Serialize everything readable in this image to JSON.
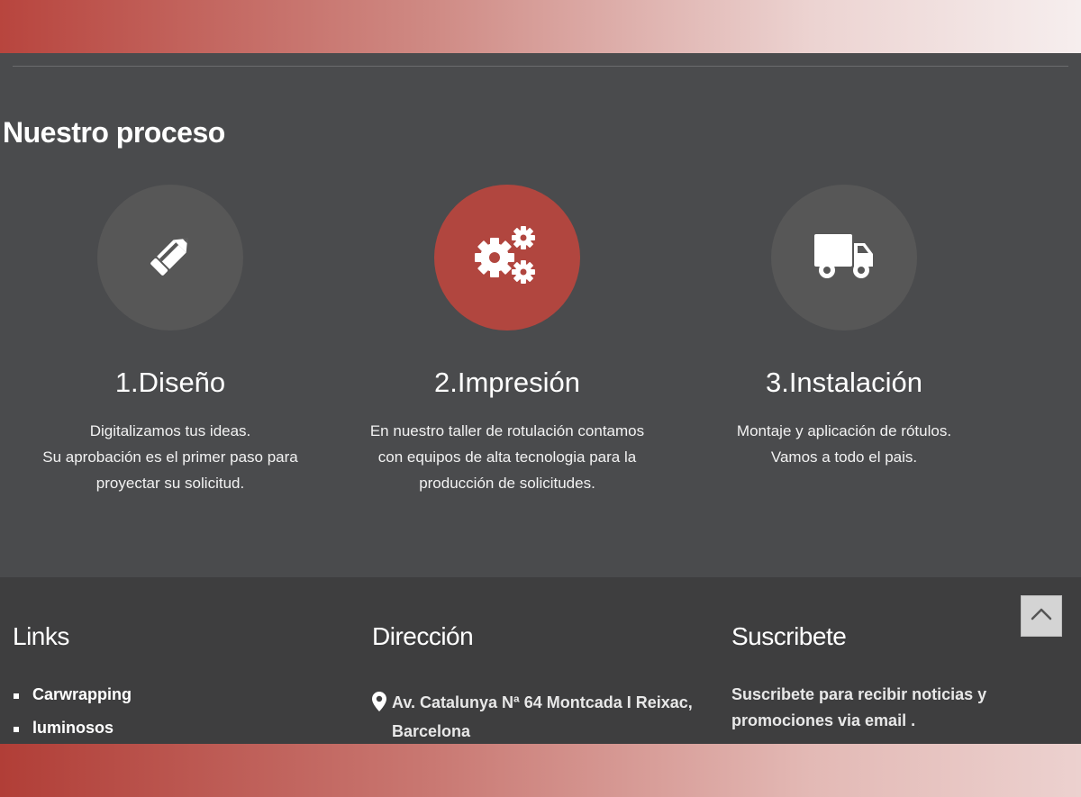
{
  "process": {
    "title": "Nuestro proceso",
    "steps": [
      {
        "icon": "pencil-icon",
        "title": "1.Diseño",
        "description": "Digitalizamos tus ideas.\nSu aprobación es el primer paso para\nproyectar su solicitud."
      },
      {
        "icon": "gears-icon",
        "title": "2.Impresión",
        "description": "En nuestro taller de rotulación contamos\ncon equipos de alta tecnologia para la\nproducción de solicitudes."
      },
      {
        "icon": "truck-icon",
        "title": "3.Instalación",
        "description": "Montaje y aplicación de rótulos.\nVamos a todo el pais."
      }
    ]
  },
  "footer": {
    "links": {
      "title": "Links",
      "items": [
        "Carwrapping",
        "luminosos"
      ]
    },
    "address": {
      "title": "Dirección",
      "icon": "map-marker-icon",
      "text": "Av. Catalunya Nª 64 Montcada I Reixac, Barcelona"
    },
    "subscribe": {
      "title": "Suscribete",
      "text": "Suscribete para recibir noticias y promociones via email ."
    },
    "back_to_top_icon": "chevron-up-icon"
  },
  "colors": {
    "process_bg": "#4a4b4d",
    "footer_bg": "#3e3e3f",
    "circle": "#575757",
    "accent": "#b1463f",
    "text": "#ffffff"
  }
}
